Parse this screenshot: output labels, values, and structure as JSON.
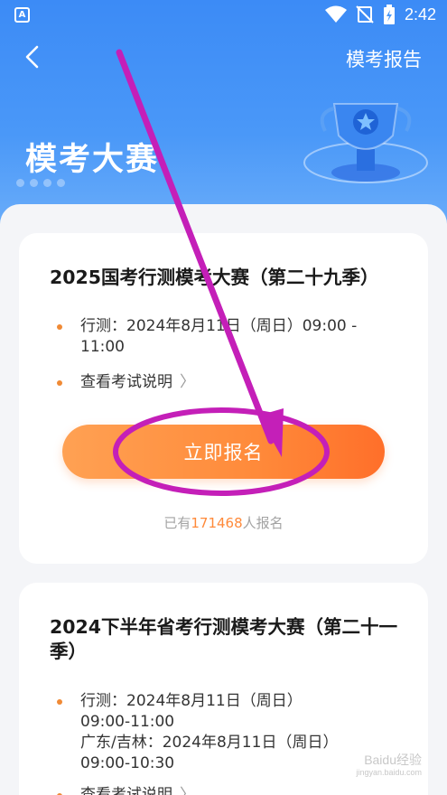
{
  "status_bar": {
    "app_icon_letter": "A",
    "time": "2:42",
    "icons": [
      "wifi-icon",
      "no-signal-icon",
      "battery-charging-icon"
    ]
  },
  "nav": {
    "back_icon": "chevron-left-icon",
    "report_label": "模考报告"
  },
  "header": {
    "title": "模考大赛",
    "decoration": "trophy-icon"
  },
  "colors": {
    "header_blue": "#3c8bf6",
    "accent_orange": "#ff8a3a",
    "bullet_orange": "#f08a35",
    "annotation_magenta": "#c41fb8"
  },
  "cards": [
    {
      "title": "2025国考行测模考大赛（第二十九季）",
      "schedule": "行测：2024年8月11日（周日）09:00 -\n11:00",
      "info_link": "查看考试说明",
      "button_label": "立即报名",
      "count_prefix": "已有",
      "count_value": "171468",
      "count_suffix": "人报名"
    },
    {
      "title": "2024下半年省考行测模考大赛（第二十一季）",
      "schedule": "行测：2024年8月11日（周日）\n09:00-11:00\n广东/吉林：2024年8月11日（周日）\n09:00-10:30",
      "info_link": "查看考试说明"
    }
  ],
  "watermark": {
    "text": "Baidu经验",
    "sub": "jingyan.baidu.com"
  }
}
